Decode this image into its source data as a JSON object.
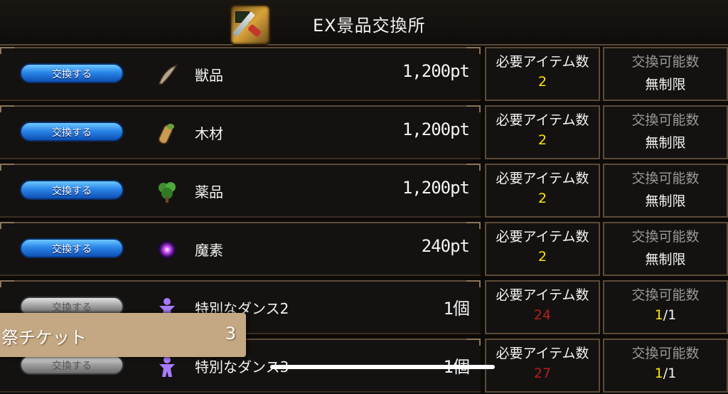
{
  "header": {
    "title": "EX景品交換所",
    "icon": "ex-shop-icon"
  },
  "labels": {
    "required_items": "必要アイテム数",
    "exchange_limit": "交換可能数"
  },
  "rows": [
    {
      "button_label": "交換する",
      "button_state": "active",
      "icon": "fang-icon",
      "name": "獣品",
      "cost": "1,200pt",
      "required_items": "2",
      "required_ok": true,
      "limit_current": "",
      "limit_total": "無制限"
    },
    {
      "button_label": "交換する",
      "button_state": "active",
      "icon": "wood-log-icon",
      "name": "木材",
      "cost": "1,200pt",
      "required_items": "2",
      "required_ok": true,
      "limit_current": "",
      "limit_total": "無制限"
    },
    {
      "button_label": "交換する",
      "button_state": "active",
      "icon": "herb-icon",
      "name": "薬品",
      "cost": "1,200pt",
      "required_items": "2",
      "required_ok": true,
      "limit_current": "",
      "limit_total": "無制限"
    },
    {
      "button_label": "交換する",
      "button_state": "active",
      "icon": "magic-orb-icon",
      "name": "魔素",
      "cost": "240pt",
      "required_items": "2",
      "required_ok": true,
      "limit_current": "",
      "limit_total": "無制限"
    },
    {
      "button_label": "交換する",
      "button_state": "disabled",
      "icon": "dance-figure-icon",
      "name": "特別なダンス2",
      "cost": "1個",
      "required_items": "24",
      "required_ok": false,
      "limit_current": "1",
      "limit_total": "/1"
    },
    {
      "button_label": "交換する",
      "button_state": "disabled",
      "icon": "dance-figure-icon",
      "name": "特別なダンス3",
      "cost": "1個",
      "required_items": "27",
      "required_ok": false,
      "limit_current": "1",
      "limit_total": "/1"
    }
  ],
  "toast": {
    "label": "祭チケット",
    "count": "3"
  },
  "colors": {
    "accent_yellow": "#ffe600",
    "insufficient_red": "#b21e1e",
    "button_blue": "#2a86e8",
    "frame_brown": "#5c4b38",
    "toast_tan": "#c4a883"
  }
}
